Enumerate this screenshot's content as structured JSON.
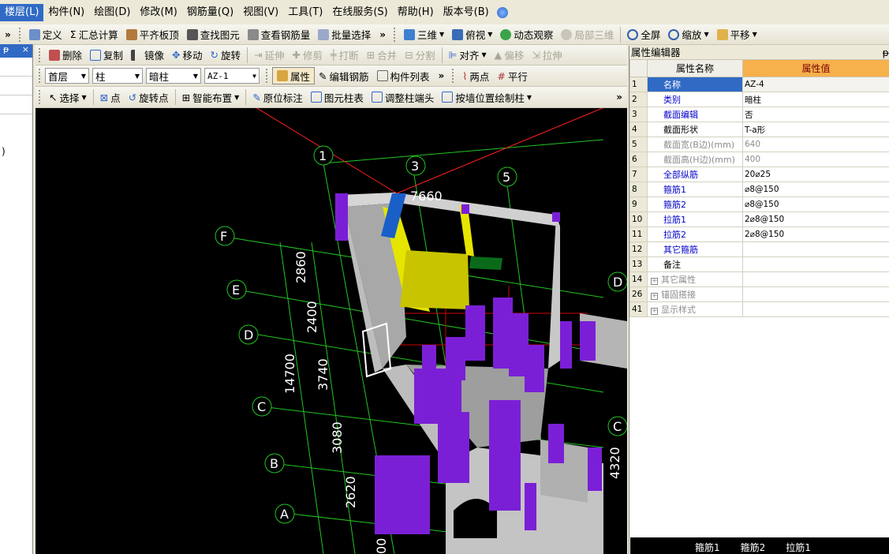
{
  "menu": [
    "楼层(L)",
    "构件(N)",
    "绘图(D)",
    "修改(M)",
    "钢筋量(Q)",
    "视图(V)",
    "工具(T)",
    "在线服务(S)",
    "帮助(H)",
    "版本号(B)"
  ],
  "toolbar1": {
    "chevron": "»",
    "items": [
      "定义",
      "汇总计算",
      "平齐板顶",
      "查找图元",
      "查看钢筋量",
      "批量选择",
      "三维",
      "俯视",
      "动态观察",
      "局部三维",
      "全屏",
      "缩放",
      "平移"
    ]
  },
  "toolbar2": {
    "items": [
      "删除",
      "复制",
      "镜像",
      "移动",
      "旋转",
      "延伸",
      "修剪",
      "打断",
      "合并",
      "分割",
      "对齐",
      "偏移",
      "拉伸"
    ]
  },
  "toolbar3": {
    "floor": "首层",
    "type": "柱",
    "sub": "暗柱",
    "component": "AZ-1",
    "items": [
      "属性",
      "编辑钢筋",
      "构件列表",
      "两点",
      "平行"
    ]
  },
  "toolbar4": {
    "items": [
      "选择",
      "点",
      "旋转点",
      "智能布置",
      "原位标注",
      "图元柱表",
      "调整柱端头",
      "按墙位置绘制柱"
    ]
  },
  "left_panel": {
    "pin": "ᵽ",
    "close": "×",
    "text": ")"
  },
  "property_editor": {
    "title": "属性编辑器",
    "pin": "ᵽ",
    "col_name": "属性名称",
    "col_value": "属性值",
    "rows": [
      {
        "no": "1",
        "name": "名称",
        "value": "AZ-4",
        "style": "blue",
        "selected": true
      },
      {
        "no": "2",
        "name": "类别",
        "value": "暗柱",
        "style": "blue"
      },
      {
        "no": "3",
        "name": "截面编辑",
        "value": "否",
        "style": "blue"
      },
      {
        "no": "4",
        "name": "截面形状",
        "value": "T-a形",
        "style": "black"
      },
      {
        "no": "5",
        "name": "截面宽(B边)(mm)",
        "value": "640",
        "style": "gray"
      },
      {
        "no": "6",
        "name": "截面高(H边)(mm)",
        "value": "400",
        "style": "gray"
      },
      {
        "no": "7",
        "name": "全部纵筋",
        "value": "20⌀25",
        "style": "blue"
      },
      {
        "no": "8",
        "name": "箍筋1",
        "value": "⌀8@150",
        "style": "blue"
      },
      {
        "no": "9",
        "name": "箍筋2",
        "value": "⌀8@150",
        "style": "blue"
      },
      {
        "no": "10",
        "name": "拉筋1",
        "value": "2⌀8@150",
        "style": "blue"
      },
      {
        "no": "11",
        "name": "拉筋2",
        "value": "2⌀8@150",
        "style": "blue"
      },
      {
        "no": "12",
        "name": "其它箍筋",
        "value": "",
        "style": "blue"
      },
      {
        "no": "13",
        "name": "备注",
        "value": "",
        "style": "black"
      },
      {
        "no": "14",
        "name": "其它属性",
        "value": "",
        "style": "gray",
        "expand": true
      },
      {
        "no": "26",
        "name": "锚固搭接",
        "value": "",
        "style": "gray",
        "expand": true
      },
      {
        "no": "41",
        "name": "显示样式",
        "value": "",
        "style": "gray",
        "expand": true
      }
    ]
  },
  "bottom_bar": [
    "箍筋1",
    "箍筋2",
    "拉筋1"
  ],
  "viewport": {
    "axis_numbers": [
      "1",
      "3",
      "5"
    ],
    "axis_letters": [
      "F",
      "E",
      "D",
      "C",
      "B",
      "A",
      "D",
      "C"
    ],
    "dims_left": [
      "2860",
      "2400",
      "3740",
      "3080",
      "2620"
    ],
    "dim_total": "14700",
    "dim_top": "7660",
    "dim_right": "4320",
    "dim_bottom": "00"
  },
  "colors": {
    "wall": "#bdbdbd",
    "column": "#7b1fd6",
    "highlight": "#d9d400",
    "selected": "#1a5fc8",
    "grid": "#22c422"
  }
}
